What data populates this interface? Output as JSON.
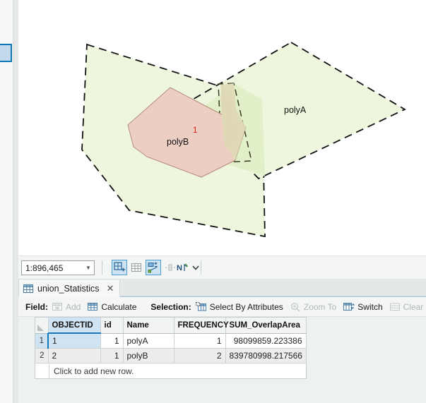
{
  "map": {
    "labels": {
      "polyA": "polyA",
      "polyB": "polyB",
      "overlap_count": "1"
    },
    "colors": {
      "poly_fill_green": "#eef7dd",
      "poly_fill_green_dark": "#e2f0c9",
      "poly_fill_salmon": "#eccfc2",
      "overlap_tan": "#e0ddbe",
      "outline": "#111111",
      "count_label": "#e01b1b"
    }
  },
  "mapbar": {
    "scale_value": "1:896,465",
    "scale_caret": "caret-down-icon",
    "tools": [
      {
        "name": "create-features-tool",
        "active": true
      },
      {
        "name": "attribute-table-tool",
        "active": false
      },
      {
        "name": "modify-features-tool",
        "active": true
      },
      {
        "name": "measure-tool",
        "active": false,
        "disabled": true
      },
      {
        "name": "north-arrow-tool",
        "active": false
      },
      {
        "name": "more-tools-caret",
        "active": false
      }
    ]
  },
  "table_pane": {
    "tab": {
      "icon": "table-icon",
      "label": "union_Statistics",
      "close": "✕"
    },
    "toolbar": {
      "field_label": "Field:",
      "field_actions": [
        {
          "label": "Add",
          "icon": "add-field-icon",
          "disabled": true
        },
        {
          "label": "Calculate",
          "icon": "calculate-field-icon",
          "disabled": false
        }
      ],
      "selection_label": "Selection:",
      "selection_actions": [
        {
          "label": "Select By Attributes",
          "icon": "select-by-attributes-icon",
          "disabled": false
        },
        {
          "label": "Zoom To",
          "icon": "zoom-to-icon",
          "disabled": true
        },
        {
          "label": "Switch",
          "icon": "switch-selection-icon",
          "disabled": false
        },
        {
          "label": "Clear",
          "icon": "clear-selection-icon",
          "disabled": true
        },
        {
          "label": "",
          "icon": "delete-selection-icon",
          "disabled": false
        }
      ]
    },
    "grid": {
      "columns": [
        "OBJECTID",
        "id",
        "Name",
        "FREQUENCY",
        "SUM_OverlapArea"
      ],
      "selected_column": "OBJECTID",
      "rows": [
        {
          "index": "1",
          "OBJECTID": "1",
          "id": "1",
          "Name": "polyA",
          "FREQUENCY": "1",
          "SUM_OverlapArea": "98099859.223386",
          "selected": true
        },
        {
          "index": "2",
          "OBJECTID": "2",
          "id": "1",
          "Name": "polyB",
          "FREQUENCY": "2",
          "SUM_OverlapArea": "839780998.217566",
          "selected": false
        }
      ],
      "add_row_text": "Click to add new row."
    }
  }
}
